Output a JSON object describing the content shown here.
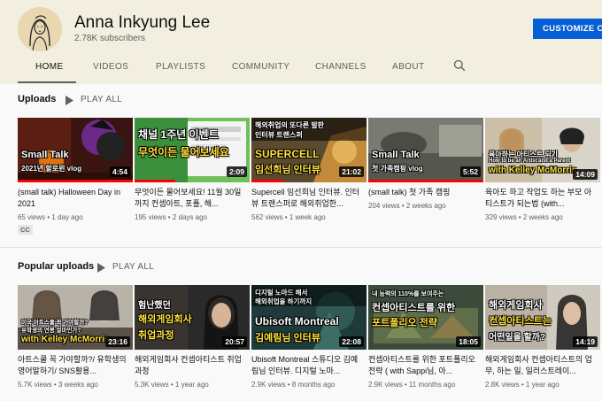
{
  "channel": {
    "name": "Anna Inkyung Lee",
    "subscribers": "2.78K subscribers",
    "customize_label": "CUSTOMIZE CHANNEL"
  },
  "tabs": [
    {
      "label": "HOME",
      "active": true
    },
    {
      "label": "VIDEOS"
    },
    {
      "label": "PLAYLISTS"
    },
    {
      "label": "COMMUNITY"
    },
    {
      "label": "CHANNELS"
    },
    {
      "label": "ABOUT"
    }
  ],
  "icons": {
    "search": "search-icon",
    "play": "play-icon"
  },
  "colors": {
    "accent": "#065fd4",
    "progress": "#ff0000",
    "header_bg": "#f2eee0"
  },
  "uploads": {
    "title": "Uploads",
    "play_all": "PLAY ALL",
    "videos": [
      {
        "thumb_text": [
          "Small Talk",
          "2021년 할로윈 vlog"
        ],
        "duration": "4:54",
        "progress": 1.0,
        "title": "(small talk) Halloween Day in 2021",
        "meta": "65 views • 1 day ago",
        "badge": "CC"
      },
      {
        "thumb_text": [
          "채널 1주년 이벤트",
          "무엇이든 물어보세요"
        ],
        "duration": "2:09",
        "progress": 0.35,
        "title": "무엇이든 물어보세요! 11월 30일까지 컨셉아트, 포폴, 해...",
        "meta": "195 views • 2 days ago"
      },
      {
        "thumb_text": [
          "해외취업의 또다른 발판",
          "인터뷰 트랜스퍼",
          "SUPERCELL",
          "임선희님 인터뷰"
        ],
        "duration": "21:02",
        "progress": 0.28,
        "title": "Supercell 임선희님 인터뷰. 인터뷰 트랜스퍼로 해외취업한...",
        "meta": "562 views • 1 week ago"
      },
      {
        "thumb_text": [
          "Small Talk",
          "첫 가족캠핑 vlog"
        ],
        "duration": "5:52",
        "progress": 1.0,
        "title": "(small talk) 첫 가족 캠핑",
        "meta": "204 views • 2 weeks ago"
      },
      {
        "thumb_text": [
          "육아하는 아티스트 되기",
          "How to be an Artist and a Parent",
          "with Kelley McMorris"
        ],
        "duration": "14:09",
        "progress": 0.0,
        "title": "육아도 하고 작업도 하는 부모 아티스트가 되는법 (with...",
        "meta": "329 views • 2 weeks ago"
      }
    ]
  },
  "popular": {
    "title": "Popular uploads",
    "play_all": "PLAY ALL",
    "videos": [
      {
        "thumb_text": [
          "미국 아트스쿨 꼭 가야할까?",
          "유학생의 연봉 얼마인가?",
          "with Kelley McMorris"
        ],
        "duration": "23:16",
        "progress": 0.0,
        "title": "아트스쿨 꼭 가야할까?/ 유학생의 영어말하기/ SNS활용...",
        "meta": "5.7K views • 3 weeks ago"
      },
      {
        "thumb_text": [
          "험난했던",
          "해외게임회사",
          "취업과정"
        ],
        "duration": "20:57",
        "progress": 0.0,
        "title": "해외게임회사 컨셉아티스트 취업과정",
        "meta": "5.3K views • 1 year ago"
      },
      {
        "thumb_text": [
          "디지털 노마드 해서",
          "해외취업을 하기까지",
          "Ubisoft Montreal",
          "김예림님 인터뷰"
        ],
        "duration": "22:08",
        "progress": 0.0,
        "title": "Ubisoft Montreal 스튜디오 김예림님 인터뷰. 디지털 노마...",
        "meta": "2.9K views • 8 months ago"
      },
      {
        "thumb_text": [
          "내 능력의 110%를 보여주는",
          "컨셉아티스트를 위한",
          "포트폴리오 전략"
        ],
        "duration": "18:05",
        "progress": 0.0,
        "title": "컨셉아티스트를 위한 포트폴리오 전략 ( with Sappi님, 아...",
        "meta": "2.9K views • 11 months ago"
      },
      {
        "thumb_text": [
          "해외게임회사",
          "컨셉아티스트는",
          "어떤일을 할까?"
        ],
        "duration": "14:19",
        "progress": 0.0,
        "title": "해외게임회사 컨셉아티스트의 업무, 하는 일, 일러스트레이...",
        "meta": "2.8K views • 1 year ago"
      }
    ]
  }
}
